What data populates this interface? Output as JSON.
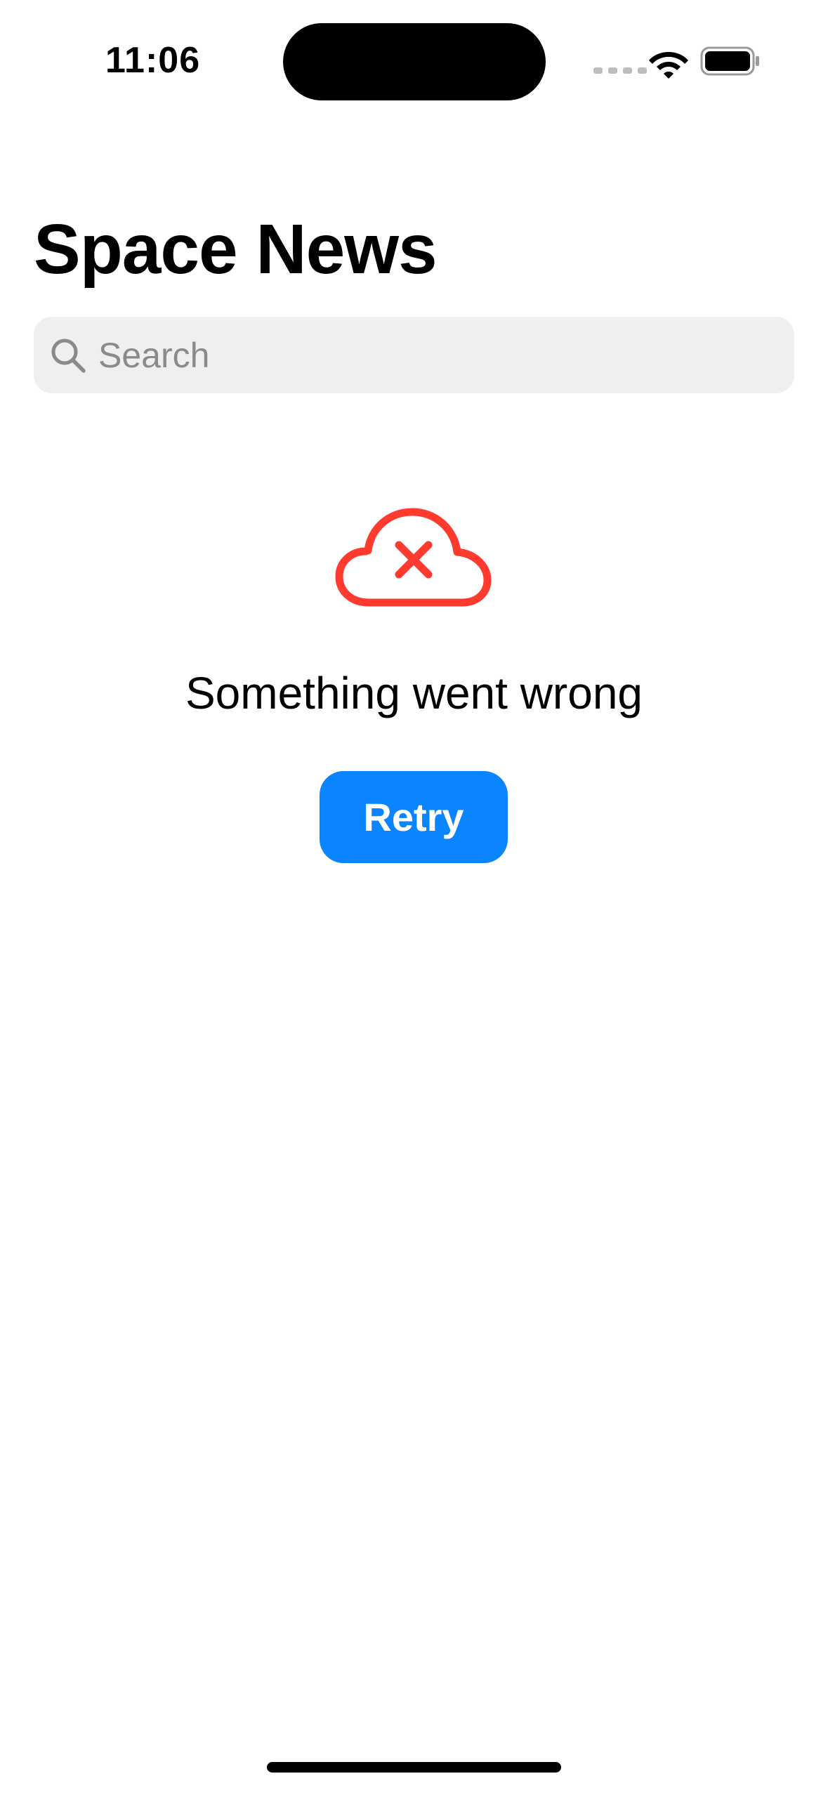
{
  "status_bar": {
    "time": "11:06",
    "icons": [
      "signal-dots-icon",
      "wifi-icon",
      "battery-icon"
    ]
  },
  "header": {
    "title": "Space News"
  },
  "search": {
    "placeholder": "Search",
    "value": "",
    "icon": "search-icon"
  },
  "error_state": {
    "icon": "cloud-error-icon",
    "message": "Something went wrong",
    "retry_label": "Retry"
  },
  "colors": {
    "accent": "#0a84ff",
    "error": "#ff3b30",
    "search_background": "#efefef",
    "placeholder": "#8a8a8e"
  }
}
